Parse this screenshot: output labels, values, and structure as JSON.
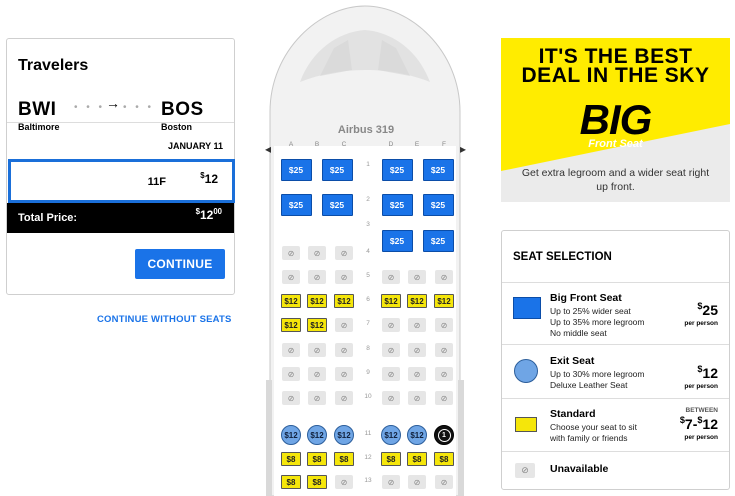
{
  "travelers": {
    "title": "Travelers",
    "origin_code": "BWI",
    "origin_city": "Baltimore",
    "destination_code": "BOS",
    "destination_city": "Boston",
    "date": "JANUARY 11",
    "selected_seat": "11F",
    "selected_seat_price_symbol": "$",
    "selected_seat_price": "12",
    "total_label": "Total Price:",
    "total_symbol": "$",
    "total_whole": "12",
    "total_cents": "00",
    "continue_label": "CONTINUE",
    "continue_without_label": "CONTINUE WITHOUT SEATS"
  },
  "plane": {
    "model": "Airbus 319",
    "columns": [
      "A",
      "B",
      "C",
      "D",
      "E",
      "F"
    ],
    "rows": [
      {
        "num": "1",
        "seats": [
          "$25",
          "$25",
          "$25",
          "$25"
        ]
      },
      {
        "num": "2",
        "seats": [
          "$25",
          "$25",
          "$25",
          "$25"
        ]
      },
      {
        "num": "3",
        "seats": [
          "$25",
          "$25"
        ]
      },
      {
        "num": "4",
        "seats": []
      },
      {
        "num": "5"
      },
      {
        "num": "6"
      },
      {
        "num": "7"
      },
      {
        "num": "8"
      },
      {
        "num": "9"
      },
      {
        "num": "10"
      },
      {
        "num": "11"
      },
      {
        "num": "12"
      },
      {
        "num": "13"
      }
    ],
    "big_price": "$25",
    "exit_price": "$12",
    "std12_price": "$12",
    "std8_price": "$8",
    "unavailable_symbol": "⊘",
    "selected_marker": "1"
  },
  "ad": {
    "headline_line1": "IT'S THE BEST",
    "headline_line2": "DEAL IN THE SKY",
    "big": "BIG",
    "front_seat": "Front Seat",
    "subtext": "Get extra legroom and a wider seat right up front.",
    "colors": {
      "yellow": "#ffec00",
      "grey": "#ebebeb"
    }
  },
  "legend": {
    "title": "SEAT SELECTION",
    "big_front": {
      "name": "Big Front Seat",
      "desc": [
        "Up to 25% wider seat",
        "Up to 35% more legroom",
        "No middle seat"
      ],
      "price_symbol": "$",
      "price": "25",
      "per": "per person"
    },
    "exit": {
      "name": "Exit Seat",
      "desc": [
        "Up to 30% more legroom",
        "Deluxe Leather Seat"
      ],
      "price_symbol": "$",
      "price": "12",
      "per": "per person"
    },
    "standard": {
      "name": "Standard",
      "desc": [
        "Choose your seat to sit",
        "with family or friends"
      ],
      "between": "BETWEEN",
      "price_symbol1": "$",
      "price_low": "7-",
      "price_symbol2": "$",
      "price_high": "12",
      "per": "per person"
    },
    "unavailable": {
      "name": "Unavailable",
      "symbol": "⊘"
    }
  }
}
